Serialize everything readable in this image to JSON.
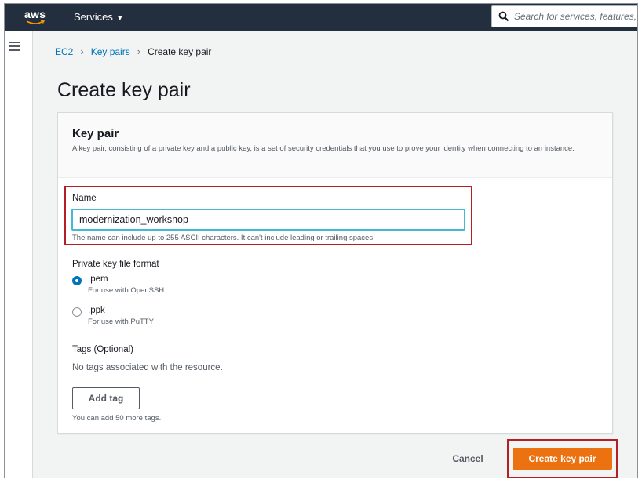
{
  "topbar": {
    "logo_text": "aws",
    "services_label": "Services",
    "search_placeholder": "Search for services, features,"
  },
  "breadcrumb": {
    "items": [
      "EC2",
      "Key pairs",
      "Create key pair"
    ]
  },
  "page": {
    "title": "Create key pair"
  },
  "panel": {
    "title": "Key pair",
    "description": "A key pair, consisting of a private key and a public key, is a set of security credentials that you use to prove your identity when connecting to an instance.",
    "name": {
      "label": "Name",
      "value": "modernization_workshop",
      "hint": "The name can include up to 255 ASCII characters. It can't include leading or trailing spaces."
    },
    "format": {
      "label": "Private key file format",
      "options": [
        {
          "title": ".pem",
          "sub": "For use with OpenSSH",
          "checked": true
        },
        {
          "title": ".ppk",
          "sub": "For use with PuTTY",
          "checked": false
        }
      ]
    },
    "tags": {
      "label": "Tags (Optional)",
      "empty_text": "No tags associated with the resource.",
      "add_label": "Add tag",
      "hint": "You can add 50 more tags."
    }
  },
  "footer": {
    "cancel_label": "Cancel",
    "create_label": "Create key pair"
  },
  "colors": {
    "nav_bg": "#232f3e",
    "link": "#0073bb",
    "primary": "#ec7211",
    "highlight": "#b31f24",
    "focus": "#44b9d6"
  },
  "icons": [
    "aws-logo-icon",
    "chevron-down-icon",
    "search-icon",
    "menu-icon",
    "chevron-right-icon"
  ]
}
